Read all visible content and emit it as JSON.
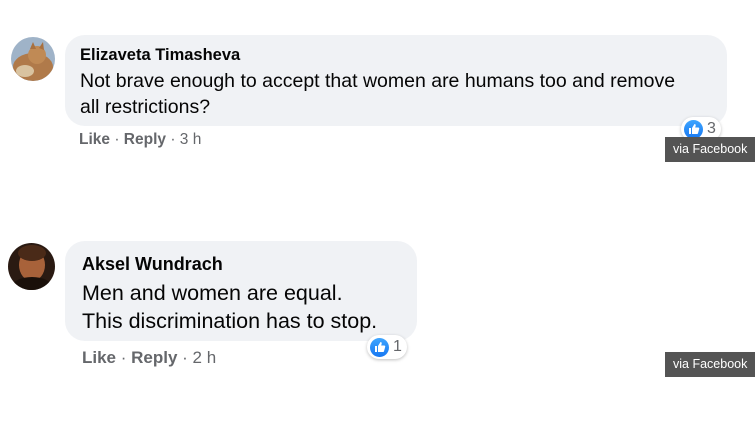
{
  "comments": [
    {
      "author": "Elizaveta Timasheva",
      "text": "Not brave enough to accept that women are humans too and remove\nall restrictions?",
      "like_label": "Like",
      "reply_label": "Reply",
      "time": "3 h",
      "reaction_count": "3",
      "badge_label": "via Facebook"
    },
    {
      "author": "Aksel Wundrach",
      "text": "Men and women are equal.\nThis discrimination has to stop.",
      "like_label": "Like",
      "reply_label": "Reply",
      "time": "2 h",
      "reaction_count": "1",
      "badge_label": "via Facebook"
    }
  ],
  "colors": {
    "bubble": "#f0f2f5",
    "secondary_text": "#65676b",
    "like_blue": "#1877f2",
    "badge_bg": "#545454"
  }
}
